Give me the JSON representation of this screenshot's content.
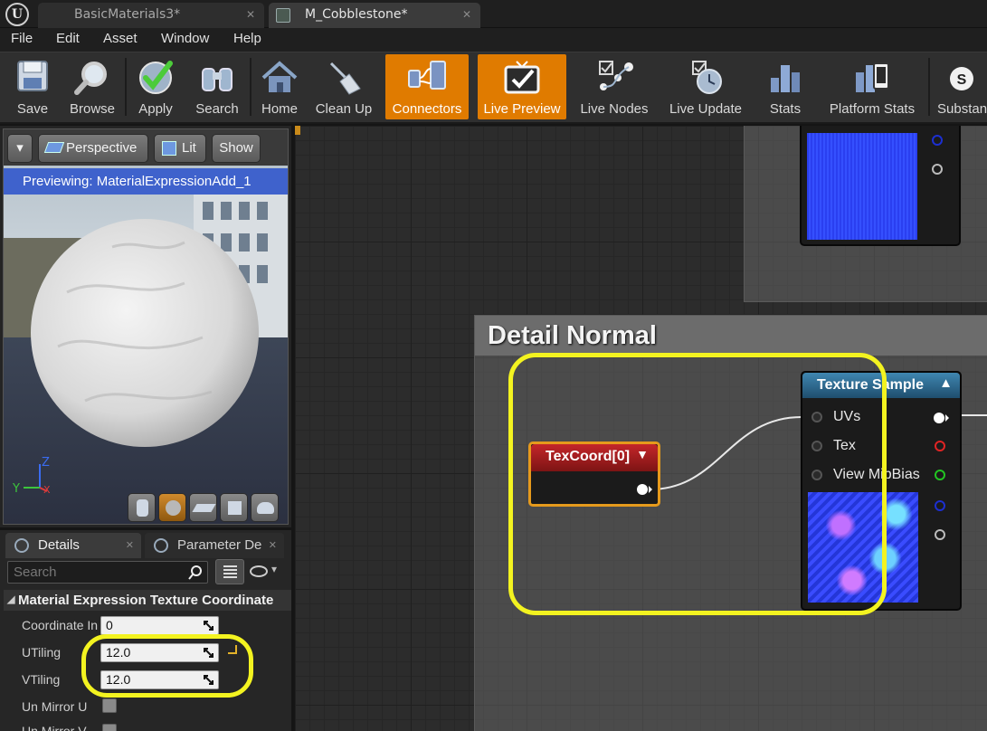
{
  "tabs": [
    {
      "label": "BasicMaterials3*",
      "active": false
    },
    {
      "label": "M_Cobblestone*",
      "active": true
    }
  ],
  "menu": [
    "File",
    "Edit",
    "Asset",
    "Window",
    "Help"
  ],
  "toolbar": {
    "save": "Save",
    "browse": "Browse",
    "apply": "Apply",
    "search": "Search",
    "home": "Home",
    "clean_up": "Clean Up",
    "connectors": "Connectors",
    "live_preview": "Live Preview",
    "live_nodes": "Live Nodes",
    "live_update": "Live Update",
    "stats": "Stats",
    "platform_stats": "Platform Stats",
    "substance": "Substan",
    "active_color": "#e07b00"
  },
  "viewport": {
    "perspective": "Perspective",
    "lit": "Lit",
    "show": "Show",
    "previewing": "Previewing: MaterialExpressionAdd_1",
    "axis_z": "Z",
    "axis_y": "Y",
    "axis_x": "X"
  },
  "details": {
    "tab_details": "Details",
    "tab_parameter": "Parameter De",
    "search_placeholder": "Search",
    "category": "Material Expression Texture Coordinate",
    "props": [
      {
        "label": "Coordinate In",
        "value": "0"
      },
      {
        "label": "UTiling",
        "value": "12.0"
      },
      {
        "label": "VTiling",
        "value": "12.0"
      },
      {
        "label": "Un Mirror U",
        "checked": false
      },
      {
        "label": "Un Mirror V",
        "checked": false
      }
    ]
  },
  "graph": {
    "comment_title": "Detail Normal",
    "texcoord_node": "TexCoord[0]",
    "texture_sample_node": "Texture Sample",
    "pins": [
      "UVs",
      "Tex",
      "View MipBias"
    ],
    "highlight_color": "#f3f320"
  }
}
